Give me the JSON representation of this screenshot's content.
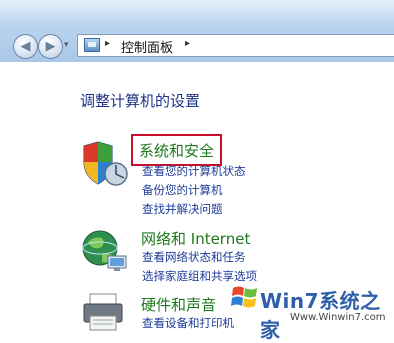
{
  "address": {
    "crumb": "控制面板",
    "separator": "▸"
  },
  "nav": {
    "back_glyph": "◀",
    "forward_glyph": "▶",
    "drop_glyph": "▾"
  },
  "page": {
    "title": "调整计算机的设置"
  },
  "categories": [
    {
      "title": "系统和安全",
      "icon": "shield-icon",
      "links": [
        "查看您的计算机状态",
        "备份您的计算机",
        "查找并解决问题"
      ]
    },
    {
      "title": "网络和 Internet",
      "icon": "network-globe-icon",
      "links": [
        "查看网络状态和任务",
        "选择家庭组和共享选项"
      ]
    },
    {
      "title": "硬件和声音",
      "icon": "printer-icon",
      "links": [
        "查看设备和打印机"
      ]
    }
  ],
  "watermark": {
    "name": "Win7系统之家",
    "url": "Www.Winwin7.com"
  },
  "colors": {
    "highlight_border": "#c8102e",
    "category_title": "#1d7a1d",
    "link": "#1e3c9a",
    "heading": "#1e3287"
  }
}
